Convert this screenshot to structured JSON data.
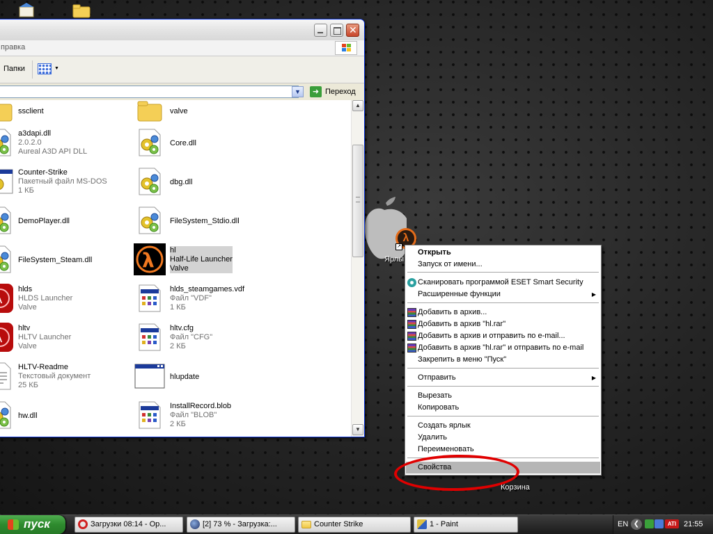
{
  "window": {
    "menu_partial": "правка",
    "toolbar": {
      "folders_label": "Папки"
    },
    "address": {
      "go_label": "Переход"
    },
    "files_left": [
      {
        "name": "ssclient",
        "sub1": "",
        "sub2": "",
        "icon": "folder-icon"
      },
      {
        "name": "a3dapi.dll",
        "sub1": "2.0.2.0",
        "sub2": "Aureal A3D API DLL",
        "icon": "dll-icon"
      },
      {
        "name": "Counter-Strike",
        "sub1": "Пакетный файл MS-DOS",
        "sub2": "1 КБ",
        "icon": "batch-file-icon"
      },
      {
        "name": "DemoPlayer.dll",
        "sub1": "",
        "sub2": "",
        "icon": "dll-icon"
      },
      {
        "name": "FileSystem_Steam.dll",
        "sub1": "",
        "sub2": "",
        "icon": "dll-icon"
      },
      {
        "name": "hlds",
        "sub1": "HLDS Launcher",
        "sub2": "Valve",
        "icon": "hlds-icon"
      },
      {
        "name": "hltv",
        "sub1": "HLTV Launcher",
        "sub2": "Valve",
        "icon": "hltv-icon"
      },
      {
        "name": "HLTV-Readme",
        "sub1": "Текстовый документ",
        "sub2": "25 КБ",
        "icon": "text-file-icon"
      },
      {
        "name": "hw.dll",
        "sub1": "",
        "sub2": "",
        "icon": "dll-icon"
      }
    ],
    "files_right": [
      {
        "name": "valve",
        "sub1": "",
        "sub2": "",
        "icon": "folder-icon"
      },
      {
        "name": "Core.dll",
        "sub1": "",
        "sub2": "",
        "icon": "dll-icon"
      },
      {
        "name": "dbg.dll",
        "sub1": "",
        "sub2": "",
        "icon": "dll-icon"
      },
      {
        "name": "FileSystem_Stdio.dll",
        "sub1": "",
        "sub2": "",
        "icon": "dll-icon"
      },
      {
        "name": "hl",
        "sub1": "Half-Life Launcher",
        "sub2": "Valve",
        "icon": "half-life-icon"
      },
      {
        "name": "hlds_steamgames.vdf",
        "sub1": "Файл \"VDF\"",
        "sub2": "1 КБ",
        "icon": "vdf-file-icon"
      },
      {
        "name": "hltv.cfg",
        "sub1": "Файл \"CFG\"",
        "sub2": "2 КБ",
        "icon": "cfg-file-icon"
      },
      {
        "name": "hlupdate",
        "sub1": "",
        "sub2": "",
        "icon": "app-window-icon"
      },
      {
        "name": "InstallRecord.blob",
        "sub1": "Файл \"BLOB\"",
        "sub2": "2 КБ",
        "icon": "blob-file-icon"
      }
    ]
  },
  "desktop": {
    "shortcut_label": "Ярлы",
    "recycle_label": "Корзина"
  },
  "context_menu": {
    "items": [
      "Открыть",
      "Запуск от имени...",
      "Сканировать программой ESET Smart Security",
      "Расширенные функции",
      "Добавить в архив...",
      "Добавить в архив \"hl.rar\"",
      "Добавить в архив и отправить по e-mail...",
      "Добавить в архив \"hl.rar\" и отправить по e-mail",
      "Закрепить в меню \"Пуск\"",
      "Отправить",
      "Вырезать",
      "Копировать",
      "Создать ярлык",
      "Удалить",
      "Переименовать",
      "Свойства"
    ],
    "highlighted": "Свойства"
  },
  "taskbar": {
    "start_label": "пуск",
    "tasks": [
      "Загрузки 08:14 - Op...",
      "[2] 73 % - Загрузка:...",
      "Counter Strike",
      "1 - Paint"
    ],
    "tray": {
      "lang": "EN",
      "clock": "21:55"
    }
  },
  "colors": {
    "highlight_circle": "#e00000",
    "menu_selection": "#b6b6b6",
    "start_green": "#2e8a2e"
  }
}
